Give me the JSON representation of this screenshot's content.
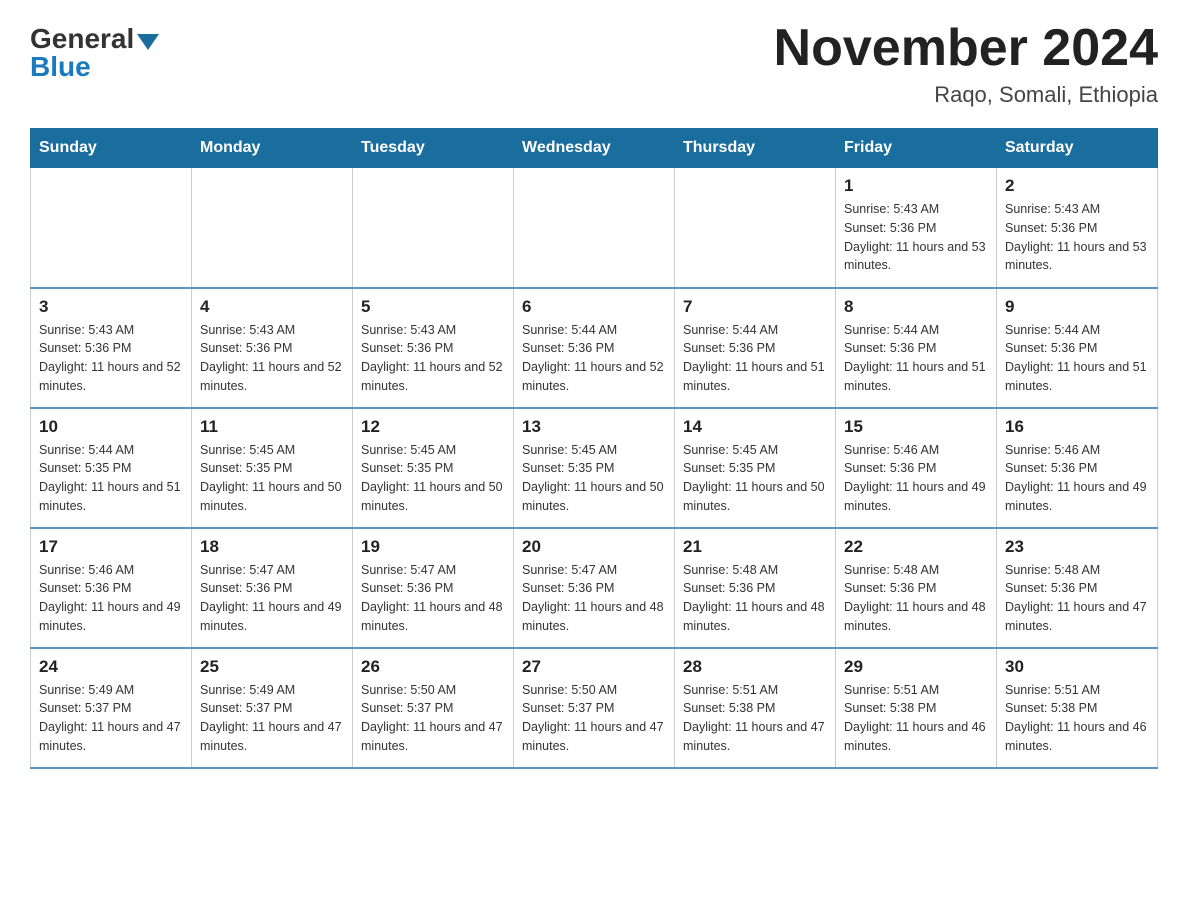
{
  "header": {
    "logo_general": "General",
    "logo_blue": "Blue",
    "month_title": "November 2024",
    "location": "Raqo, Somali, Ethiopia"
  },
  "days_of_week": [
    "Sunday",
    "Monday",
    "Tuesday",
    "Wednesday",
    "Thursday",
    "Friday",
    "Saturday"
  ],
  "weeks": [
    [
      {
        "day": "",
        "info": ""
      },
      {
        "day": "",
        "info": ""
      },
      {
        "day": "",
        "info": ""
      },
      {
        "day": "",
        "info": ""
      },
      {
        "day": "",
        "info": ""
      },
      {
        "day": "1",
        "info": "Sunrise: 5:43 AM\nSunset: 5:36 PM\nDaylight: 11 hours and 53 minutes."
      },
      {
        "day": "2",
        "info": "Sunrise: 5:43 AM\nSunset: 5:36 PM\nDaylight: 11 hours and 53 minutes."
      }
    ],
    [
      {
        "day": "3",
        "info": "Sunrise: 5:43 AM\nSunset: 5:36 PM\nDaylight: 11 hours and 52 minutes."
      },
      {
        "day": "4",
        "info": "Sunrise: 5:43 AM\nSunset: 5:36 PM\nDaylight: 11 hours and 52 minutes."
      },
      {
        "day": "5",
        "info": "Sunrise: 5:43 AM\nSunset: 5:36 PM\nDaylight: 11 hours and 52 minutes."
      },
      {
        "day": "6",
        "info": "Sunrise: 5:44 AM\nSunset: 5:36 PM\nDaylight: 11 hours and 52 minutes."
      },
      {
        "day": "7",
        "info": "Sunrise: 5:44 AM\nSunset: 5:36 PM\nDaylight: 11 hours and 51 minutes."
      },
      {
        "day": "8",
        "info": "Sunrise: 5:44 AM\nSunset: 5:36 PM\nDaylight: 11 hours and 51 minutes."
      },
      {
        "day": "9",
        "info": "Sunrise: 5:44 AM\nSunset: 5:36 PM\nDaylight: 11 hours and 51 minutes."
      }
    ],
    [
      {
        "day": "10",
        "info": "Sunrise: 5:44 AM\nSunset: 5:35 PM\nDaylight: 11 hours and 51 minutes."
      },
      {
        "day": "11",
        "info": "Sunrise: 5:45 AM\nSunset: 5:35 PM\nDaylight: 11 hours and 50 minutes."
      },
      {
        "day": "12",
        "info": "Sunrise: 5:45 AM\nSunset: 5:35 PM\nDaylight: 11 hours and 50 minutes."
      },
      {
        "day": "13",
        "info": "Sunrise: 5:45 AM\nSunset: 5:35 PM\nDaylight: 11 hours and 50 minutes."
      },
      {
        "day": "14",
        "info": "Sunrise: 5:45 AM\nSunset: 5:35 PM\nDaylight: 11 hours and 50 minutes."
      },
      {
        "day": "15",
        "info": "Sunrise: 5:46 AM\nSunset: 5:36 PM\nDaylight: 11 hours and 49 minutes."
      },
      {
        "day": "16",
        "info": "Sunrise: 5:46 AM\nSunset: 5:36 PM\nDaylight: 11 hours and 49 minutes."
      }
    ],
    [
      {
        "day": "17",
        "info": "Sunrise: 5:46 AM\nSunset: 5:36 PM\nDaylight: 11 hours and 49 minutes."
      },
      {
        "day": "18",
        "info": "Sunrise: 5:47 AM\nSunset: 5:36 PM\nDaylight: 11 hours and 49 minutes."
      },
      {
        "day": "19",
        "info": "Sunrise: 5:47 AM\nSunset: 5:36 PM\nDaylight: 11 hours and 48 minutes."
      },
      {
        "day": "20",
        "info": "Sunrise: 5:47 AM\nSunset: 5:36 PM\nDaylight: 11 hours and 48 minutes."
      },
      {
        "day": "21",
        "info": "Sunrise: 5:48 AM\nSunset: 5:36 PM\nDaylight: 11 hours and 48 minutes."
      },
      {
        "day": "22",
        "info": "Sunrise: 5:48 AM\nSunset: 5:36 PM\nDaylight: 11 hours and 48 minutes."
      },
      {
        "day": "23",
        "info": "Sunrise: 5:48 AM\nSunset: 5:36 PM\nDaylight: 11 hours and 47 minutes."
      }
    ],
    [
      {
        "day": "24",
        "info": "Sunrise: 5:49 AM\nSunset: 5:37 PM\nDaylight: 11 hours and 47 minutes."
      },
      {
        "day": "25",
        "info": "Sunrise: 5:49 AM\nSunset: 5:37 PM\nDaylight: 11 hours and 47 minutes."
      },
      {
        "day": "26",
        "info": "Sunrise: 5:50 AM\nSunset: 5:37 PM\nDaylight: 11 hours and 47 minutes."
      },
      {
        "day": "27",
        "info": "Sunrise: 5:50 AM\nSunset: 5:37 PM\nDaylight: 11 hours and 47 minutes."
      },
      {
        "day": "28",
        "info": "Sunrise: 5:51 AM\nSunset: 5:38 PM\nDaylight: 11 hours and 47 minutes."
      },
      {
        "day": "29",
        "info": "Sunrise: 5:51 AM\nSunset: 5:38 PM\nDaylight: 11 hours and 46 minutes."
      },
      {
        "day": "30",
        "info": "Sunrise: 5:51 AM\nSunset: 5:38 PM\nDaylight: 11 hours and 46 minutes."
      }
    ]
  ]
}
